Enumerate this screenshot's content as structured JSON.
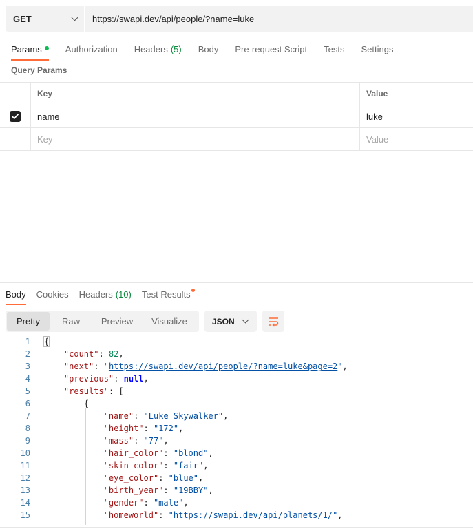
{
  "request": {
    "method": "GET",
    "url": "https://swapi.dev/api/people/?name=luke"
  },
  "request_tabs": [
    {
      "label": "Params",
      "active": true,
      "indicator": "green-dot"
    },
    {
      "label": "Authorization"
    },
    {
      "label": "Headers",
      "count": "(5)"
    },
    {
      "label": "Body"
    },
    {
      "label": "Pre-request Script"
    },
    {
      "label": "Tests"
    },
    {
      "label": "Settings"
    }
  ],
  "query_params": {
    "title": "Query Params",
    "headers": {
      "key": "Key",
      "value": "Value"
    },
    "rows": [
      {
        "checked": true,
        "key": "name",
        "value": "luke"
      }
    ],
    "placeholder": {
      "key": "Key",
      "value": "Value"
    }
  },
  "response_tabs": [
    {
      "label": "Body",
      "active": true
    },
    {
      "label": "Cookies"
    },
    {
      "label": "Headers",
      "count": "(10)"
    },
    {
      "label": "Test Results",
      "indicator": "orange-dot"
    }
  ],
  "view_modes": [
    "Pretty",
    "Raw",
    "Preview",
    "Visualize"
  ],
  "active_view": "Pretty",
  "format": "JSON",
  "code_lines": [
    {
      "n": "1",
      "text": "{"
    },
    {
      "n": "2",
      "text": "    \"count\": 82,"
    },
    {
      "n": "3",
      "text": "    \"next\": \"https://swapi.dev/api/people/?name=luke&page=2\","
    },
    {
      "n": "4",
      "text": "    \"previous\": null,"
    },
    {
      "n": "5",
      "text": "    \"results\": ["
    },
    {
      "n": "6",
      "text": "        {"
    },
    {
      "n": "7",
      "text": "            \"name\": \"Luke Skywalker\","
    },
    {
      "n": "8",
      "text": "            \"height\": \"172\","
    },
    {
      "n": "9",
      "text": "            \"mass\": \"77\","
    },
    {
      "n": "10",
      "text": "            \"hair_color\": \"blond\","
    },
    {
      "n": "11",
      "text": "            \"skin_color\": \"fair\","
    },
    {
      "n": "12",
      "text": "            \"eye_color\": \"blue\","
    },
    {
      "n": "13",
      "text": "            \"birth_year\": \"19BBY\","
    },
    {
      "n": "14",
      "text": "            \"gender\": \"male\","
    },
    {
      "n": "15",
      "text": "            \"homeworld\": \"https://swapi.dev/api/planets/1/\","
    }
  ],
  "colors": {
    "accent": "#ff6c37",
    "params_indicator": "#0cbb52",
    "json_key": "#a31515",
    "json_string": "#0451a5",
    "json_number": "#098658",
    "json_keyword": "#0000ff",
    "line_number": "#4a7fa8"
  }
}
